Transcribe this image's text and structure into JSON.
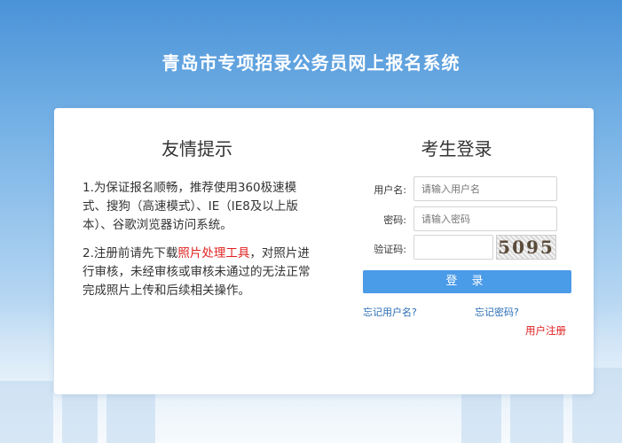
{
  "page": {
    "title": "青岛市专项招录公务员网上报名系统"
  },
  "tips": {
    "title": "友情提示",
    "item1": "1.为保证报名顺畅，推荐使用360极速模式、搜狗（高速模式）、IE（IE8及以上版本）、谷歌浏览器访问系统。",
    "item2_before": "2.注册前请先下载",
    "item2_link": "照片处理工具",
    "item2_after": "，对照片进行审核，未经审核或审核未通过的无法正常完成照片上传和后续相关操作。"
  },
  "login": {
    "title": "考生登录",
    "username_label": "用户名:",
    "username_placeholder": "请输入用户名",
    "password_label": "密码:",
    "password_placeholder": "请输入密码",
    "captcha_label": "验证码:",
    "captcha_text": "5095",
    "submit_label": "登 录",
    "forgot_username": "忘记用户名?",
    "forgot_password": "忘记密码?",
    "register": "用户注册"
  },
  "colors": {
    "accent": "#4a9be8",
    "link": "#2a6db5",
    "highlight": "#e02020"
  }
}
